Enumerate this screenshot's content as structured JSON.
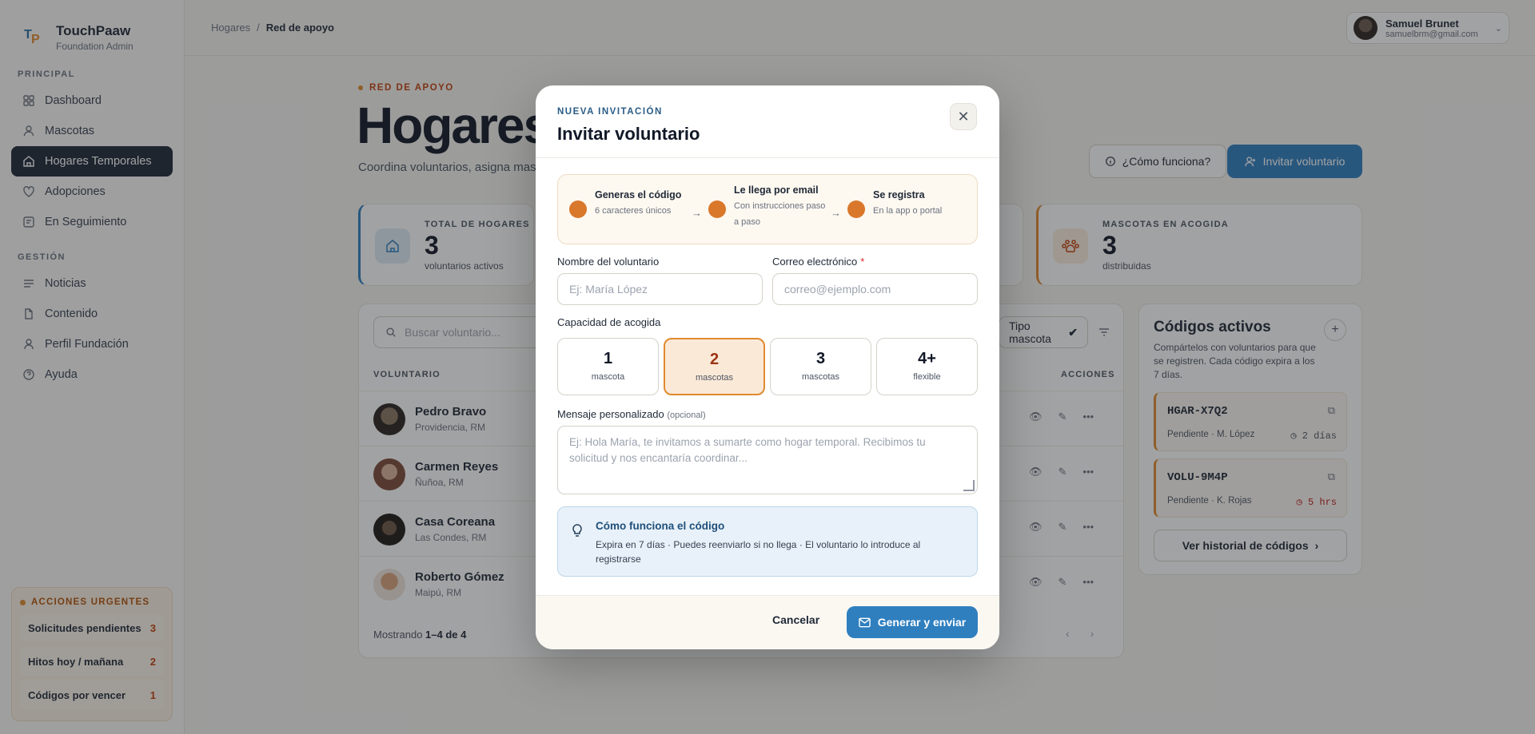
{
  "app": {
    "name": "TouchPaaw",
    "subtitle": "Foundation Admin",
    "logo_letters": [
      "T",
      "P"
    ]
  },
  "sidebar": {
    "section_principal": "PRINCIPAL",
    "principal": [
      {
        "label": "Dashboard",
        "icon": "grid-icon"
      },
      {
        "label": "Mascotas",
        "icon": "user-icon"
      },
      {
        "label": "Hogares Temporales",
        "icon": "home-icon",
        "active": true
      },
      {
        "label": "Adopciones",
        "icon": "heart-icon"
      },
      {
        "label": "En Seguimiento",
        "icon": "list-icon"
      }
    ],
    "section_gestion": "GESTIÓN",
    "gestion": [
      {
        "label": "Noticias",
        "icon": "lines-icon"
      },
      {
        "label": "Contenido",
        "icon": "file-icon"
      },
      {
        "label": "Perfil Fundación",
        "icon": "person-icon"
      },
      {
        "label": "Ayuda",
        "icon": "help-icon"
      }
    ],
    "urgent": {
      "title": "ACCIONES URGENTES",
      "items": [
        {
          "label": "Solicitudes pendientes",
          "count": "3"
        },
        {
          "label": "Hitos hoy / mañana",
          "count": "2"
        },
        {
          "label": "Códigos por vencer",
          "count": "1"
        }
      ]
    }
  },
  "header": {
    "breadcrumb": [
      "Hogares",
      "/",
      "Red de apoyo"
    ],
    "user": {
      "name": "Samuel Brunet",
      "email": "samuelbrm@gmail.com"
    }
  },
  "main": {
    "kicker": "RED DE APOYO",
    "title": "Hogares",
    "description": "Coordina voluntarios, asigna mas",
    "help_button": "¿Cómo funciona?",
    "invite_button": "Invitar voluntario",
    "stats": [
      {
        "label": "TOTAL DE HOGARES",
        "value": "3",
        "sub": "voluntarios activos"
      },
      {
        "label": "MASCOTAS EN ACOGIDA",
        "value": "3",
        "sub": "distribuidas"
      }
    ],
    "table": {
      "search_placeholder": "Buscar voluntario...",
      "filter_label": "Tipo mascota",
      "col_voluntario": "VOLUNTARIO",
      "col_acciones": "ACCIONES",
      "rows": [
        {
          "name": "Pedro Bravo",
          "location": "Providencia, RM"
        },
        {
          "name": "Carmen Reyes",
          "location": "Ñuñoa, RM"
        },
        {
          "name": "Casa Coreana",
          "location": "Las Condes, RM"
        },
        {
          "name": "Roberto Gómez",
          "location": "Maipú, RM"
        }
      ],
      "footer_prefix": "Mostrando",
      "footer_range": "1–4 de 4"
    },
    "codes": {
      "title": "Códigos activos",
      "description": "Compártelos con voluntarios para que se registren. Cada código expira a los 7 días.",
      "items": [
        {
          "code": "HGAR-X7Q2",
          "status": "Pendiente · M. López",
          "expires": "2 días",
          "urgent": false
        },
        {
          "code": "VOLU-9M4P",
          "status": "Pendiente · K. Rojas",
          "expires": "5 hrs",
          "urgent": true
        }
      ],
      "history_button": "Ver historial de códigos"
    }
  },
  "modal": {
    "kicker": "NUEVA INVITACIÓN",
    "title": "Invitar voluntario",
    "steps": [
      {
        "title": "Generas el código",
        "sub": "6 caracteres únicos"
      },
      {
        "title": "Le llega por email",
        "sub": "Con instrucciones paso a paso"
      },
      {
        "title": "Se registra",
        "sub": "En la app o portal"
      }
    ],
    "name_label": "Nombre del voluntario",
    "name_placeholder": "Ej: María López",
    "email_label": "Correo electrónico",
    "email_required": "*",
    "email_placeholder": "correo@ejemplo.com",
    "capacity_label": "Capacidad de acogida",
    "capacity_options": [
      {
        "n": "1",
        "unit": "mascota"
      },
      {
        "n": "2",
        "unit": "mascotas",
        "selected": true
      },
      {
        "n": "3",
        "unit": "mascotas"
      },
      {
        "n": "4+",
        "unit": "flexible"
      }
    ],
    "message_label": "Mensaje personalizado",
    "message_optional": "(opcional)",
    "message_placeholder": "Ej: Hola María, te invitamos a sumarte como hogar temporal. Recibimos tu solicitud y nos encantaría coordinar...",
    "info_title": "Cómo funciona el código",
    "info_text": "Expira en 7 días · Puedes reenviarlo si no llega · El voluntario lo introduce al registrarse",
    "cancel": "Cancelar",
    "submit": "Generar y enviar"
  },
  "colors": {
    "accent": "#2f7fbf",
    "orange": "#e08a2e",
    "sidebar_active": "#1f2937"
  }
}
